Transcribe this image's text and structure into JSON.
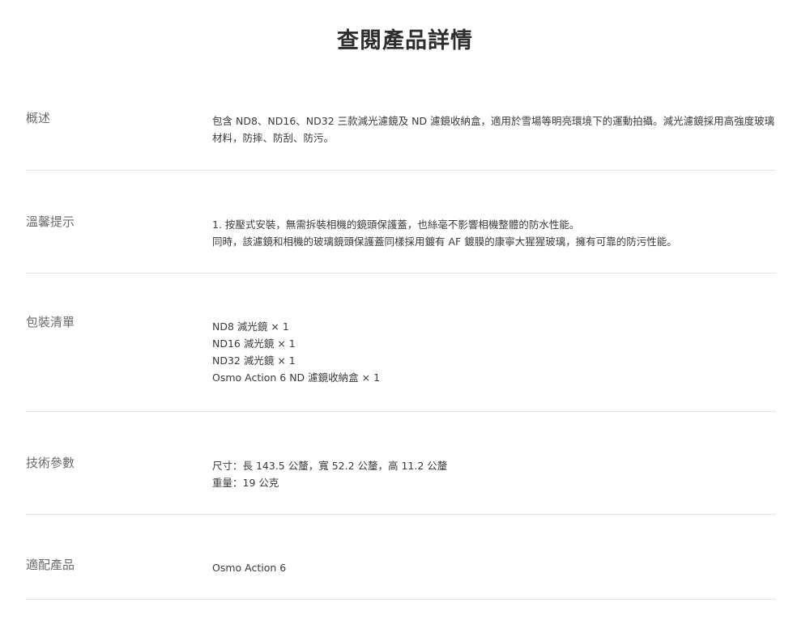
{
  "page": {
    "title": "查閱產品詳情"
  },
  "sections": [
    {
      "label": "概述",
      "lines": [
        "包含 ND8、ND16、ND32 三款減光濾鏡及 ND 濾鏡收納盒，適用於雪場等明亮環境下的運動拍攝。減光濾鏡採用高強度玻璃材料，防摔、防刮、防污。"
      ]
    },
    {
      "label": "溫馨提示",
      "lines": [
        "1. 按壓式安裝，無需拆裝相機的鏡頭保護蓋，也絲毫不影響相機整體的防水性能。",
        "同時，該濾鏡和相機的玻璃鏡頭保護蓋同樣採用鍍有 AF 鍍膜的康寧大猩猩玻璃，擁有可靠的防污性能。"
      ]
    },
    {
      "label": "包裝清單",
      "lines": [
        "ND8 減光鏡 × 1",
        "ND16 減光鏡 × 1",
        "ND32 減光鏡 × 1",
        "Osmo Action 6 ND 濾鏡收納盒 × 1"
      ]
    },
    {
      "label": "技術參數",
      "lines": [
        "尺寸：長 143.5 公釐，寬 52.2 公釐，高 11.2 公釐",
        "重量：19 公克"
      ]
    },
    {
      "label": "適配產品",
      "lines": [
        "Osmo Action 6"
      ]
    }
  ]
}
